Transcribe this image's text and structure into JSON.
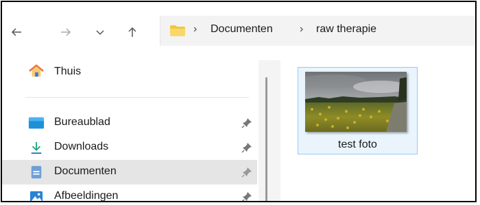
{
  "nav": {
    "back_icon": "arrow-left-icon",
    "forward_icon": "arrow-right-icon",
    "recent_icon": "chevron-down-icon",
    "up_icon": "arrow-up-icon"
  },
  "breadcrumb": {
    "items": [
      "Documenten",
      "raw therapie"
    ],
    "separator": "›"
  },
  "sidebar": {
    "items": [
      {
        "label": "Thuis",
        "icon": "home-icon"
      },
      {
        "label": "Bureaublad",
        "icon": "desktop-icon",
        "pinned": true
      },
      {
        "label": "Downloads",
        "icon": "download-icon",
        "pinned": true
      },
      {
        "label": "Documenten",
        "icon": "document-icon",
        "pinned": true,
        "selected": true
      },
      {
        "label": "Afbeeldingen",
        "icon": "pictures-icon",
        "pinned": true
      }
    ]
  },
  "files": [
    {
      "name": "test foto",
      "type": "image",
      "selected": true
    }
  ],
  "colors": {
    "selection_border": "#99c9f2",
    "selection_fill": "#eaf4fd",
    "sidebar_selected": "#e5e5e5",
    "address_bar": "#f3f3f3",
    "folder_yellow": "#f4c542"
  }
}
